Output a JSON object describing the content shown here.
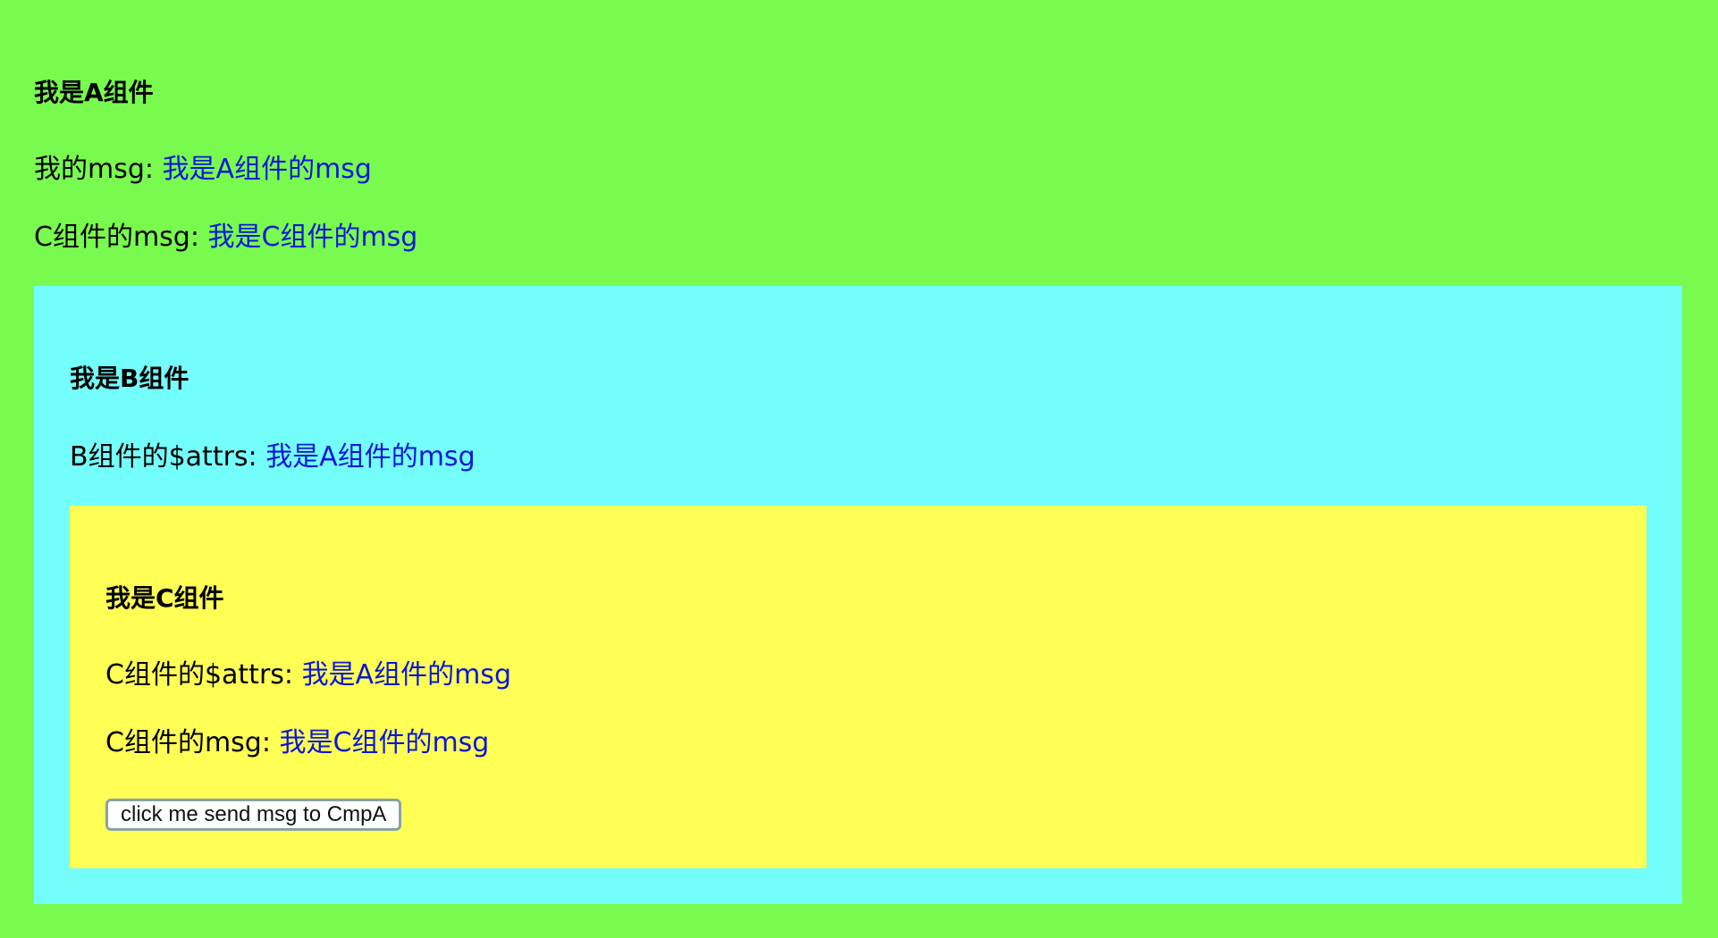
{
  "cmp_a": {
    "title": "我是A组件",
    "my_msg_label": "我的msg: ",
    "my_msg_value": "我是A组件的msg",
    "c_msg_label": "C组件的msg: ",
    "c_msg_value": "我是C组件的msg"
  },
  "cmp_b": {
    "title": "我是B组件",
    "attrs_label": "B组件的$attrs: ",
    "attrs_value": "我是A组件的msg"
  },
  "cmp_c": {
    "title": "我是C组件",
    "attrs_label": "C组件的$attrs: ",
    "attrs_value": "我是A组件的msg",
    "msg_label": "C组件的msg: ",
    "msg_value": "我是C组件的msg",
    "button_label": "click me send msg to CmpA"
  },
  "colors": {
    "cmp_a_bg": "#78fb4e",
    "cmp_b_bg": "#73fdfb",
    "cmp_c_bg": "#fffe55",
    "value_text": "#0a16d9"
  }
}
